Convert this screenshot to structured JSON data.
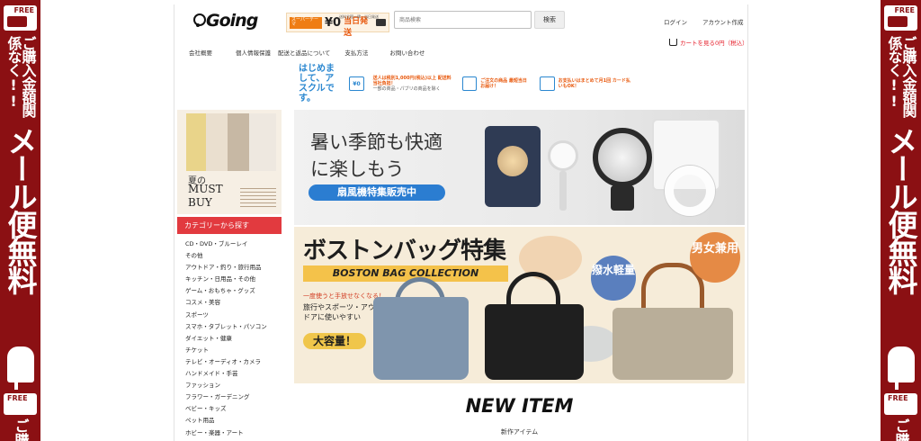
{
  "side_banner": {
    "free_label": "FREE",
    "vertical_small": "ご購入金額関係なく!!",
    "vertical_big": "メール便無料",
    "vertical_tail": "ご購"
  },
  "header": {
    "logo_text": "Going",
    "promo": {
      "tag": "スーパーテーマ",
      "price": "¥0",
      "small_note": "送料全国一律・当日発送",
      "same_day": "当日発送"
    },
    "search": {
      "placeholder": "商品検索",
      "button": "検索"
    },
    "login": "ログイン",
    "register": "アカウント作成",
    "cart": "カートを見る0円（税込）"
  },
  "nav": {
    "items": [
      "会社概要",
      "個人情報保護",
      "配送と返品について",
      "支払方法",
      "お問い合わせ"
    ]
  },
  "info_strip": {
    "welcome": "はじめまして、アスクルです。",
    "yen_tile": "¥0",
    "block1_main": "送人は税別1,000円(税込)以上 配送料当社負担！",
    "block1_small": "一部の商品・パブリの商品を除く",
    "block2_main": "ご注文の商品 最短当日お届け！",
    "block3_main": "お支払いはまとめて月1回 カード払いもOK！"
  },
  "promo_tile": {
    "summer": "夏の",
    "must": "MUST",
    "buy": "BUY"
  },
  "categories": {
    "header": "カテゴリーから探す",
    "items": [
      "CD・DVD・ブルーレイ",
      "その他",
      "アウトドア・釣り・旅行用品",
      "キッチン・日用品・その他",
      "ゲーム・おもちゃ・グッズ",
      "コスメ・美容",
      "スポーツ",
      "スマホ・タブレット・パソコン",
      "ダイエット・健康",
      "チケット",
      "テレビ・オーディオ・カメラ",
      "ハンドメイド・手芸",
      "ファッション",
      "フラワー・ガーデニング",
      "ベビー・キッズ",
      "ペット用品",
      "ホビー・楽器・アート"
    ]
  },
  "banner_fan": {
    "line1": "暑い季節も快適",
    "line2": "に楽しもう",
    "pill": "扇風機特集販売中"
  },
  "banner_bag": {
    "title": "ボストンバッグ特集",
    "subtitle": "BOSTON BAG COLLECTION",
    "copy1": "一度使うと手放せなくなる！",
    "copy2": "旅行やスポーツ・アウトドアに使いやすい",
    "big": "大容量！",
    "badge_blue": "撥水軽量",
    "badge_orange": "男女兼用"
  },
  "new_item": {
    "title": "NEW ITEM",
    "subtitle": "新作アイテム"
  }
}
